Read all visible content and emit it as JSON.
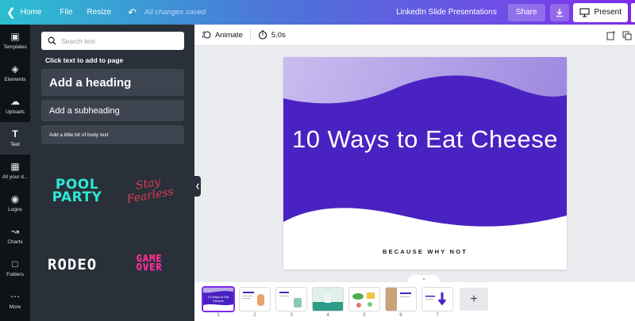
{
  "topbar": {
    "home_label": "Home",
    "file_label": "File",
    "resize_label": "Resize",
    "saved_status": "All changes saved",
    "doc_title": "LinkedIn Slide Presentations",
    "share_label": "Share",
    "present_label": "Present"
  },
  "rail": {
    "templates": "Templates",
    "elements": "Elements",
    "uploads": "Uploads",
    "text": "Text",
    "all_designs": "All your d...",
    "logos": "Logos",
    "charts": "Charts",
    "folders": "Folders",
    "more": "More"
  },
  "panel": {
    "search_placeholder": "Search text",
    "hint": "Click text to add to page",
    "heading_label": "Add a heading",
    "subheading_label": "Add a subheading",
    "body_label": "Add a little bit of body text",
    "combos": {
      "pool": "POOL PARTY",
      "fearless": "Stay Fearless",
      "rodeo": "RODEO",
      "gameover": "GAME OVER"
    }
  },
  "editor": {
    "animate_label": "Animate",
    "duration_label": "5.0s"
  },
  "slide": {
    "title": "10 Ways to Eat Cheese",
    "subtitle": "BECAUSE WHY NOT"
  },
  "thumbnails": {
    "numbers": [
      "1",
      "2",
      "3",
      "4",
      "5",
      "6",
      "7"
    ],
    "thumb1_title": "10 Ways to Eat Cheese"
  },
  "colors": {
    "brand_purple": "#7d2ae8",
    "slide_purple": "#4a22c2",
    "slide_light": "#b9abe6",
    "panel_bg": "#293039",
    "rail_bg": "#0e1318"
  },
  "icons": {
    "back": "chevron-left-icon",
    "undo": "undo-icon",
    "download": "download-icon",
    "present": "present-screen-icon",
    "animate": "animate-icon",
    "timer": "timer-icon",
    "add_page": "plus-icon"
  }
}
